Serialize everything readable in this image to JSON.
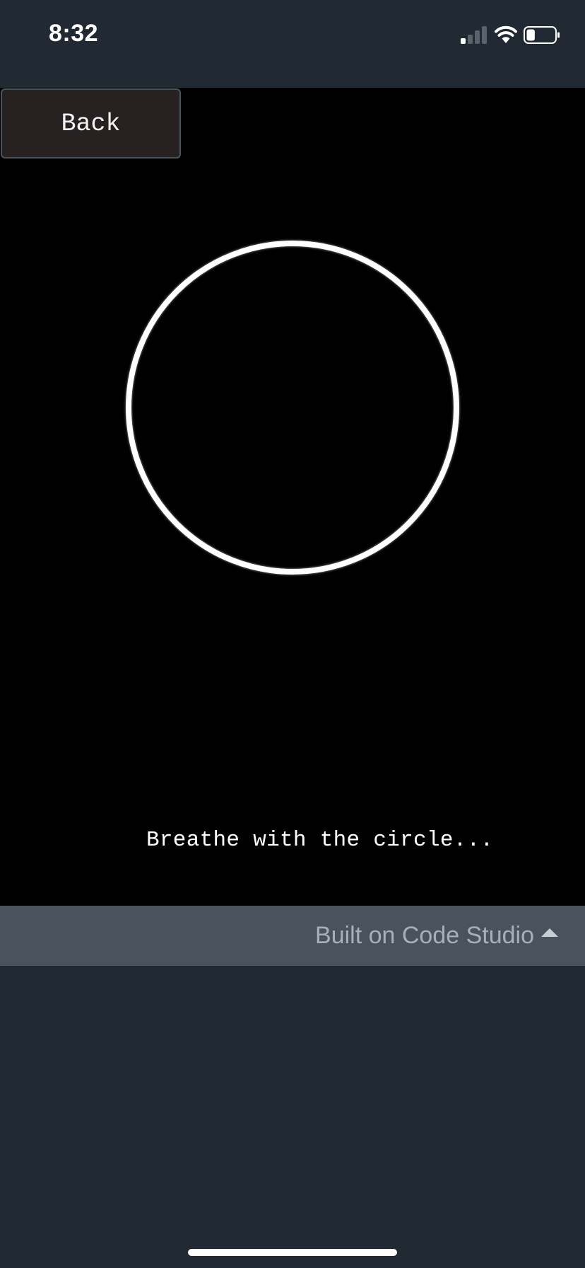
{
  "status_bar": {
    "time": "8:32",
    "signal_bars": 1,
    "signal_bars_total": 4,
    "wifi": "wifi-icon",
    "battery_level": 0.3
  },
  "app": {
    "back_label": "Back",
    "instruction": "Breathe with the circle...",
    "background_color": "#000000",
    "circle_color": "#ffffff"
  },
  "footer": {
    "label": "Built on Code Studio",
    "icon": "caret-up-icon"
  }
}
